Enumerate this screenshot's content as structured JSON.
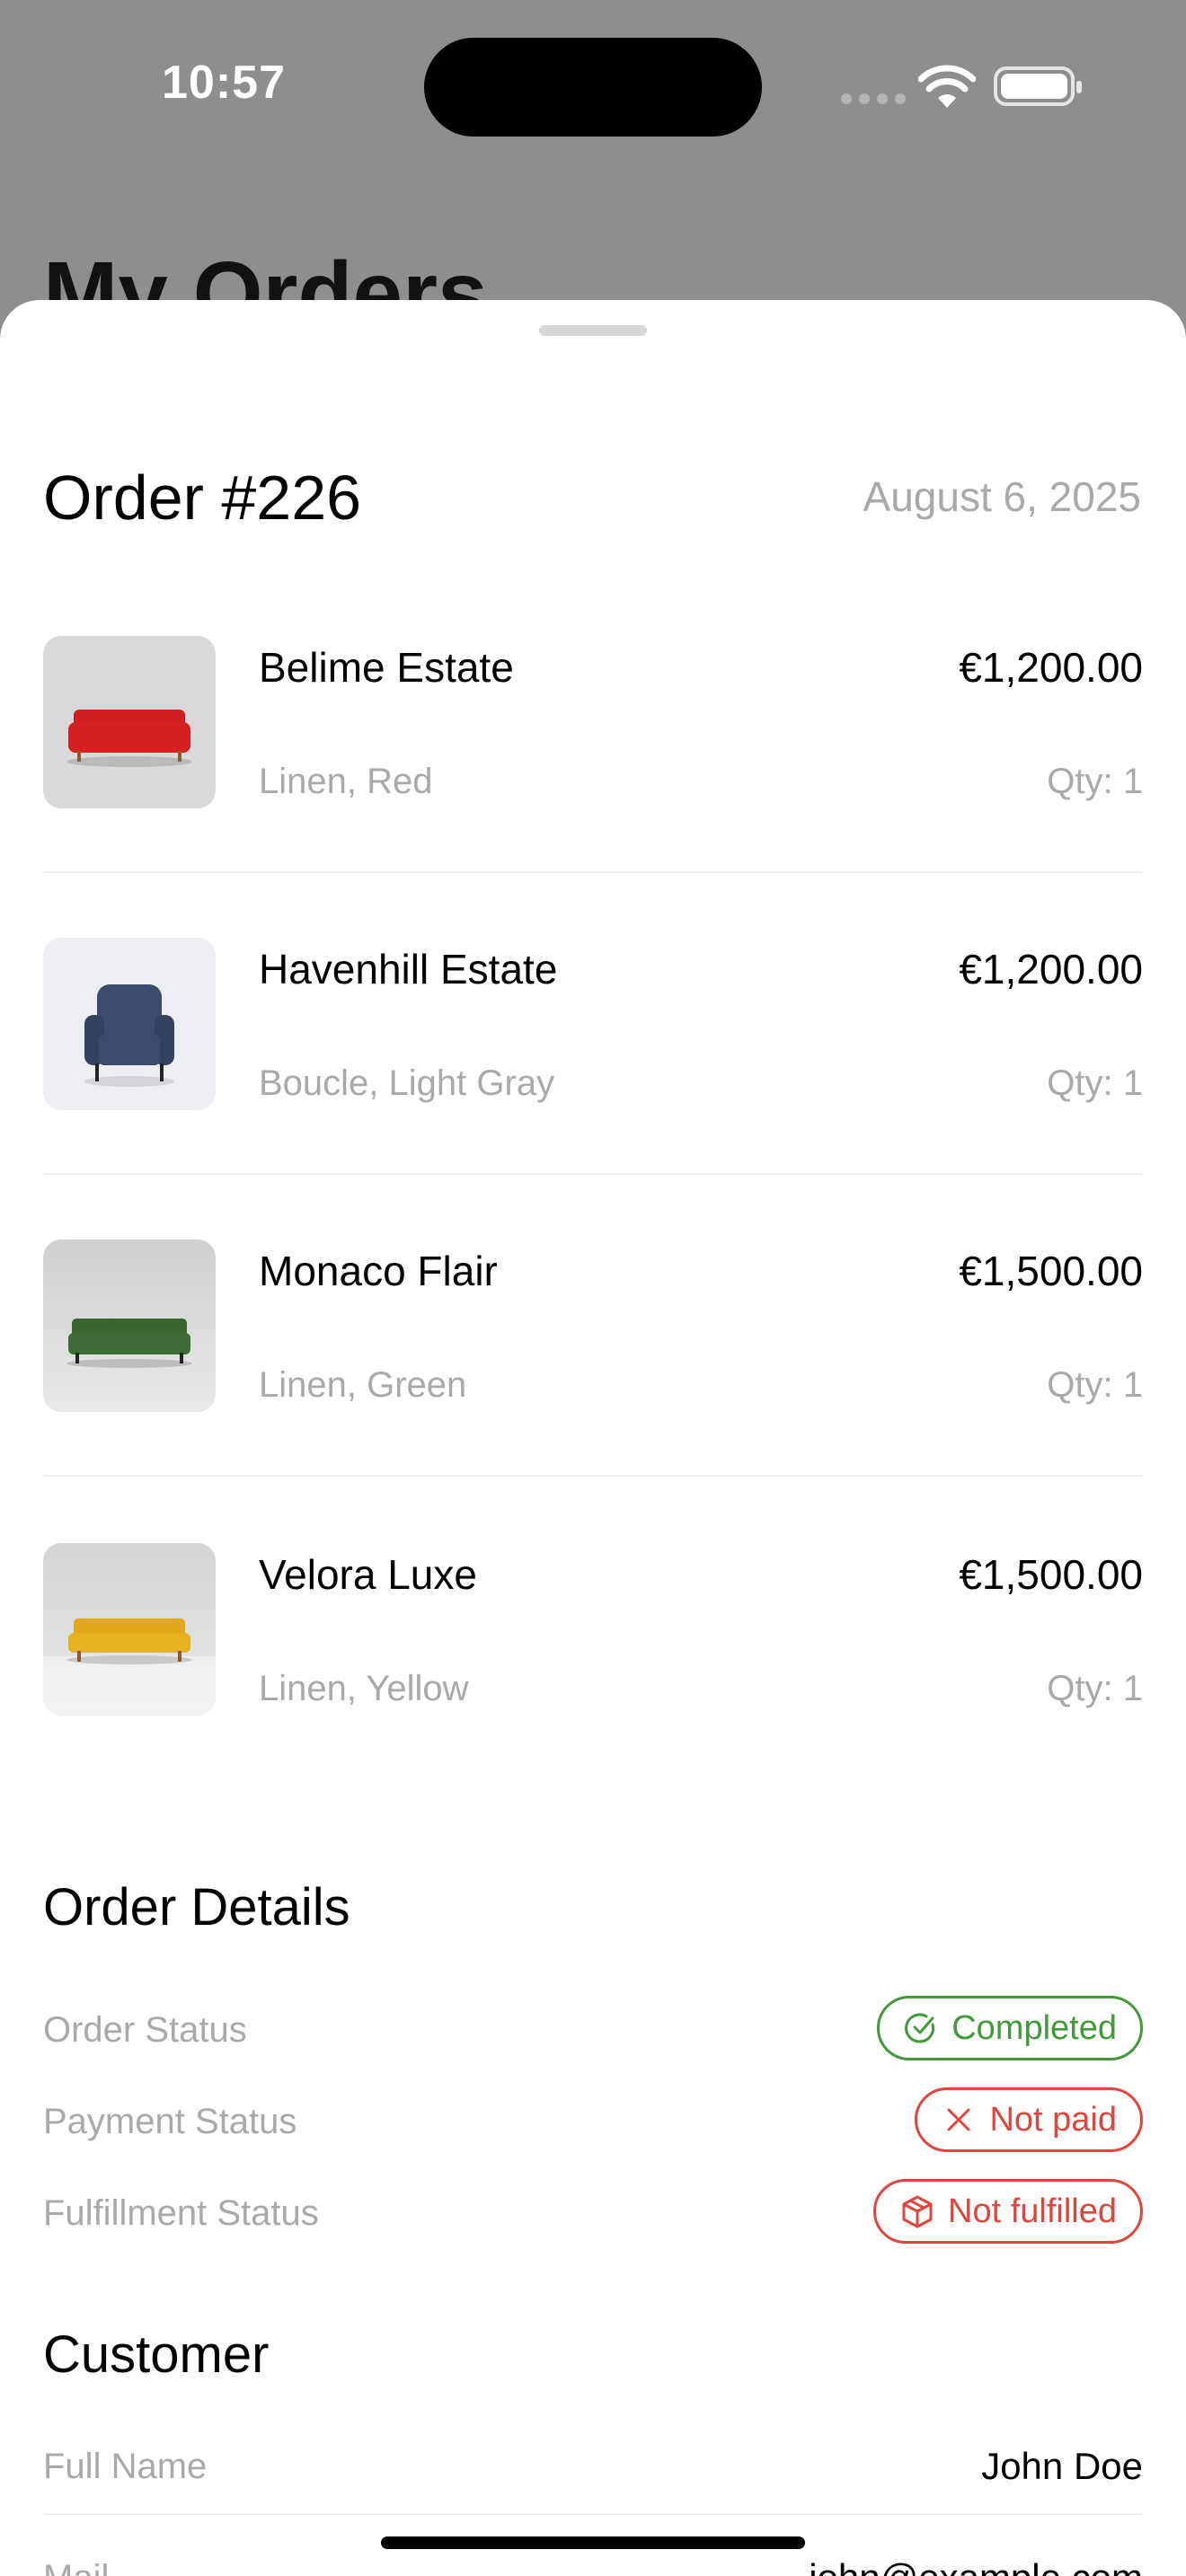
{
  "status_bar": {
    "time": "10:57"
  },
  "background": {
    "title": "My Orders"
  },
  "order": {
    "title": "Order #226",
    "date": "August 6, 2025"
  },
  "items": [
    {
      "name": "Belime Estate",
      "price": "€1,200.00",
      "variant": "Linen, Red",
      "qty": "Qty: 1",
      "color": "#d42020"
    },
    {
      "name": "Havenhill Estate",
      "price": "€1,200.00",
      "variant": "Boucle, Light Gray",
      "qty": "Qty: 1",
      "color": "#3c4a6e"
    },
    {
      "name": "Monaco Flair",
      "price": "€1,500.00",
      "variant": "Linen, Green",
      "qty": "Qty: 1",
      "color": "#3d6b36"
    },
    {
      "name": "Velora Luxe",
      "price": "€1,500.00",
      "variant": "Linen, Yellow",
      "qty": "Qty: 1",
      "color": "#e8b21e"
    }
  ],
  "details": {
    "title": "Order Details",
    "order_status_label": "Order Status",
    "order_status": "Completed",
    "payment_status_label": "Payment Status",
    "payment_status": "Not paid",
    "fulfillment_status_label": "Fulfillment Status",
    "fulfillment_status": "Not fulfilled"
  },
  "customer": {
    "title": "Customer",
    "full_name_label": "Full Name",
    "full_name": "John Doe",
    "mail_label": "Mail",
    "mail": "john@example.com"
  },
  "colors": {
    "success": "#3f9a37",
    "danger": "#e0453d",
    "muted": "#a9a9a9"
  }
}
